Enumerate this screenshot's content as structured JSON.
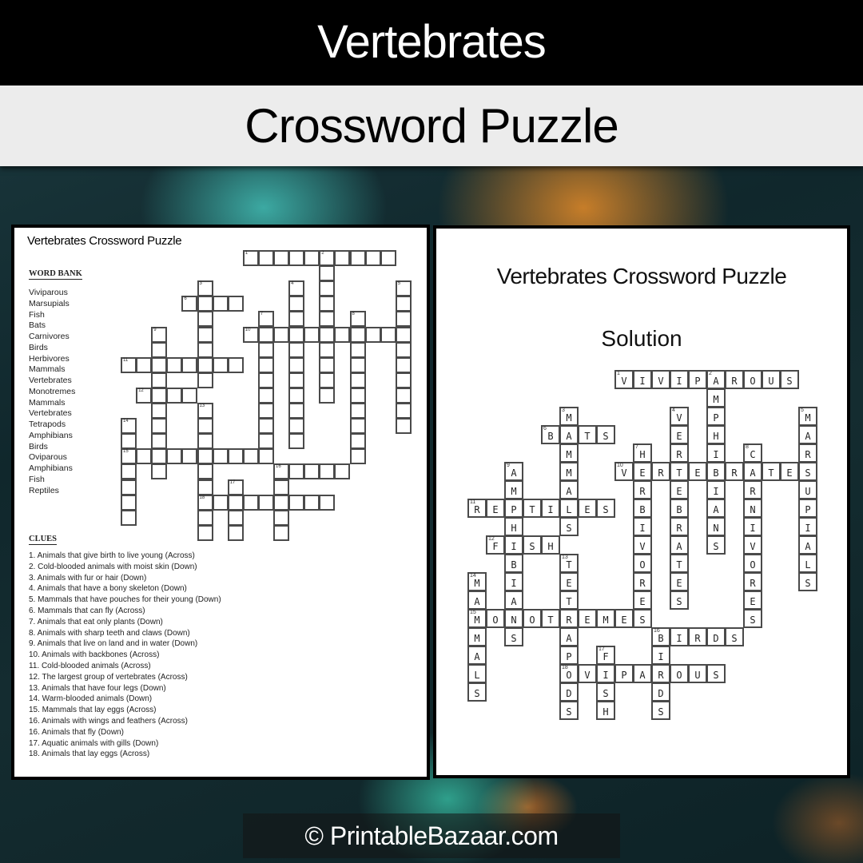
{
  "header": {
    "title": "Vertebrates",
    "subtitle": "Crossword Puzzle"
  },
  "puzzle_page": {
    "title": "Vertebrates Crossword Puzzle",
    "word_bank_heading": "WORD BANK",
    "word_bank": [
      "Viviparous",
      "Marsupials",
      "Fish",
      "Bats",
      "Carnivores",
      "Birds",
      "Herbivores",
      "Mammals",
      "Vertebrates",
      "Monotremes",
      "Mammals",
      "Vertebrates",
      "Tetrapods",
      "Amphibians",
      "Birds",
      "Oviparous",
      "Amphibians",
      "Fish",
      "Reptiles"
    ],
    "clues_heading": "CLUES",
    "clues": [
      "1. Animals that give birth to live young (Across)",
      "2. Cold-blooded animals with moist skin (Down)",
      "3. Animals with fur or hair (Down)",
      "4. Animals that have a bony skeleton (Down)",
      "5. Mammals that have pouches for their young (Down)",
      "6. Mammals that can fly (Across)",
      "7. Animals that eat only plants (Down)",
      "8. Animals with sharp teeth and claws (Down)",
      "9. Animals that live on land and in water (Down)",
      "10. Animals with backbones (Across)",
      "11. Cold-blooded animals (Across)",
      "12. The largest group of vertebrates (Across)",
      "13. Animals that have four legs (Down)",
      "14. Warm-blooded  animals (Down)",
      "15. Mammals that lay eggs (Across)",
      "16. Animals with wings and feathers (Across)",
      "16. Animals that fly (Down)",
      "17. Aquatic animals with gills (Down)",
      "18. Animals that lay eggs (Across)"
    ]
  },
  "solution_page": {
    "title": "Vertebrates Crossword Puzzle",
    "subtitle": "Solution"
  },
  "crossword": {
    "words": [
      {
        "num": 1,
        "dir": "across",
        "row": 0,
        "col": 8,
        "answer": "VIVIPAROUS"
      },
      {
        "num": 2,
        "dir": "down",
        "row": 0,
        "col": 13,
        "answer": "AMPHIBIANS"
      },
      {
        "num": 3,
        "dir": "down",
        "row": 2,
        "col": 5,
        "answer": "MAMMALS"
      },
      {
        "num": 4,
        "dir": "down",
        "row": 2,
        "col": 11,
        "answer": "VERTEBRATES"
      },
      {
        "num": 5,
        "dir": "down",
        "row": 2,
        "col": 18,
        "answer": "MARSUPIALS"
      },
      {
        "num": 6,
        "dir": "across",
        "row": 3,
        "col": 4,
        "answer": "BATS"
      },
      {
        "num": 7,
        "dir": "down",
        "row": 4,
        "col": 9,
        "answer": "HERBIVORES"
      },
      {
        "num": 8,
        "dir": "down",
        "row": 4,
        "col": 15,
        "answer": "CARNIVORES"
      },
      {
        "num": 9,
        "dir": "down",
        "row": 5,
        "col": 2,
        "answer": "AMPHIBIANS"
      },
      {
        "num": 10,
        "dir": "across",
        "row": 5,
        "col": 8,
        "answer": "VERTEBRATES"
      },
      {
        "num": 11,
        "dir": "across",
        "row": 7,
        "col": 0,
        "answer": "REPTILES"
      },
      {
        "num": 12,
        "dir": "across",
        "row": 9,
        "col": 1,
        "answer": "FISH"
      },
      {
        "num": 13,
        "dir": "down",
        "row": 10,
        "col": 5,
        "answer": "TETRAPODS"
      },
      {
        "num": 14,
        "dir": "down",
        "row": 11,
        "col": 0,
        "answer": "MAMMALS"
      },
      {
        "num": 15,
        "dir": "across",
        "row": 13,
        "col": 0,
        "answer": "MONOTREMES"
      },
      {
        "num": 16,
        "dir": "across",
        "row": 14,
        "col": 10,
        "answer": "BIRDS"
      },
      {
        "num": 16,
        "dir": "down",
        "row": 14,
        "col": 10,
        "answer": "BIRDS"
      },
      {
        "num": 17,
        "dir": "down",
        "row": 15,
        "col": 7,
        "answer": "FISH"
      },
      {
        "num": 18,
        "dir": "across",
        "row": 16,
        "col": 5,
        "answer": "OVIPAROUS"
      }
    ]
  },
  "footer": {
    "copyright": "© PrintableBazaar.com"
  }
}
